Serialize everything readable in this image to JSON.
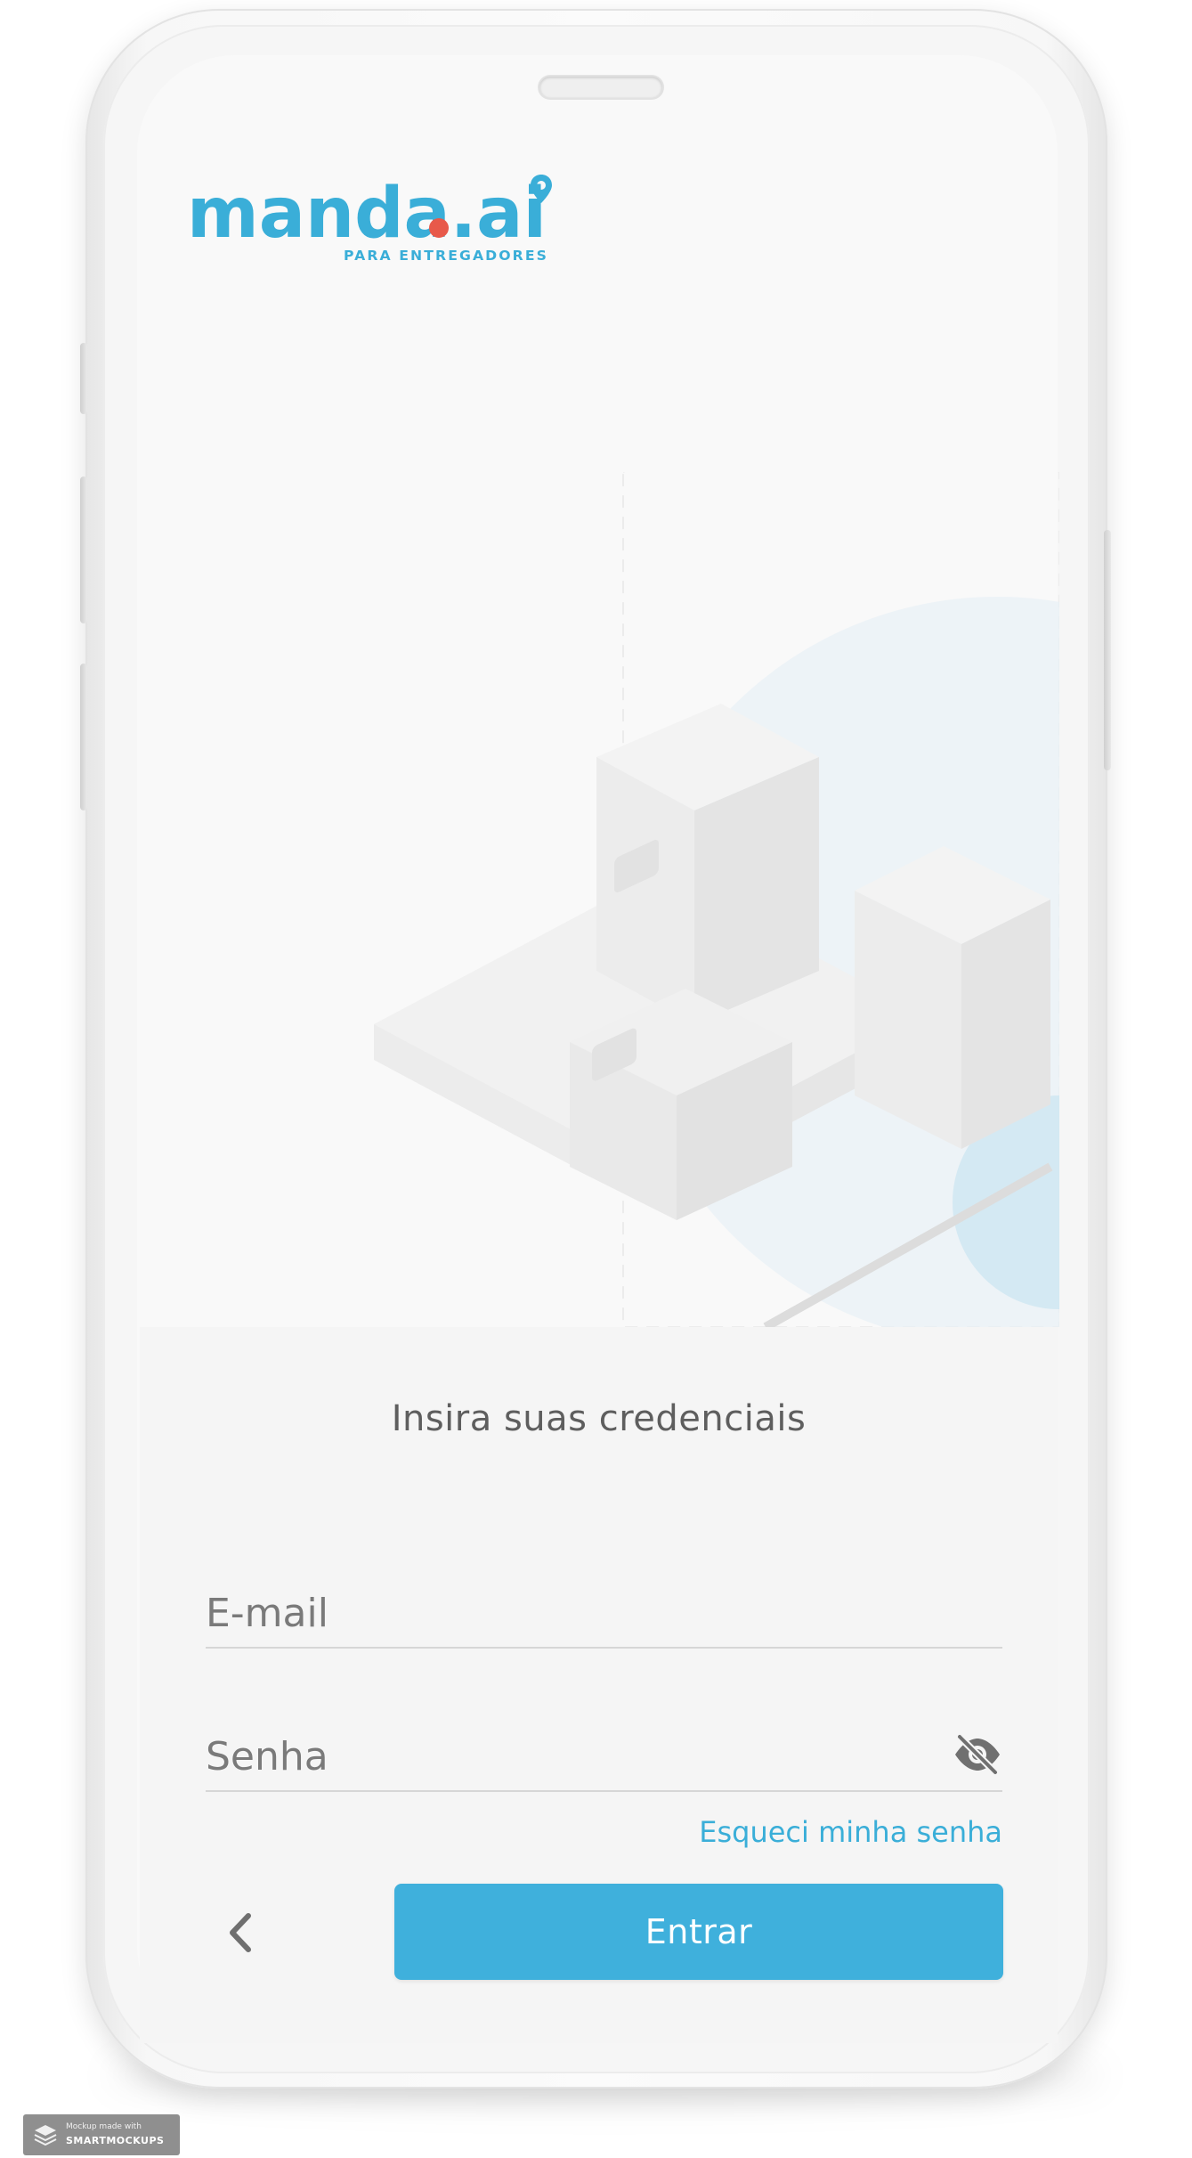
{
  "app": {
    "logo": {
      "wordmark": "manda.ai",
      "tagline": "PARA ENTREGADORES",
      "brand_color": "#3aaed8",
      "dot_color": "#e8594a"
    }
  },
  "login": {
    "heading": "Insira suas credenciais",
    "email": {
      "placeholder": "E-mail",
      "value": ""
    },
    "password": {
      "placeholder": "Senha",
      "value": "",
      "toggle_icon": "eye-off-icon"
    },
    "forgot_link": "Esqueci minha senha",
    "back_icon": "chevron-left-icon",
    "submit_label": "Entrar",
    "accent_color": "#3fb0dc"
  },
  "watermark": {
    "line1": "Mockup made with",
    "line2": "SMARTMOCKUPS"
  }
}
